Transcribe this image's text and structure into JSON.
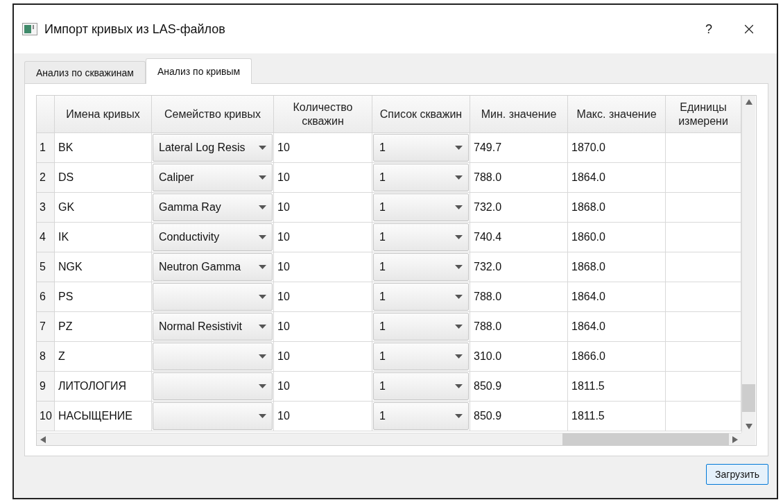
{
  "window": {
    "title": "Импорт кривых из LAS-файлов",
    "help": "?"
  },
  "tabs": [
    {
      "label": "Анализ по скважинам",
      "selected": false
    },
    {
      "label": "Анализ по кривым",
      "selected": true
    }
  ],
  "table": {
    "columns": [
      "Имена кривых",
      "Семейство кривых",
      "Количество скважин",
      "Список скважин",
      "Мин. значение",
      "Макс. значение",
      "Единицы измерени"
    ],
    "rows": [
      {
        "index": "1",
        "name": "BK",
        "family": "Lateral Log Resis",
        "count": "10",
        "wells": "1",
        "min": "749.7",
        "max": "1870.0"
      },
      {
        "index": "2",
        "name": "DS",
        "family": "Caliper",
        "count": "10",
        "wells": "1",
        "min": "788.0",
        "max": "1864.0"
      },
      {
        "index": "3",
        "name": "GK",
        "family": "Gamma Ray",
        "count": "10",
        "wells": "1",
        "min": "732.0",
        "max": "1868.0"
      },
      {
        "index": "4",
        "name": "IK",
        "family": "Conductivity",
        "count": "10",
        "wells": "1",
        "min": "740.4",
        "max": "1860.0"
      },
      {
        "index": "5",
        "name": "NGK",
        "family": "Neutron Gamma",
        "count": "10",
        "wells": "1",
        "min": "732.0",
        "max": "1868.0"
      },
      {
        "index": "6",
        "name": "PS",
        "count": "10",
        "wells": "1",
        "min": "788.0",
        "max": "1864.0"
      },
      {
        "index": "7",
        "name": "PZ",
        "family": "Normal Resistivit",
        "count": "10",
        "wells": "1",
        "min": "788.0",
        "max": "1864.0"
      },
      {
        "index": "8",
        "name": "Z",
        "count": "10",
        "wells": "1",
        "min": "310.0",
        "max": "1866.0"
      },
      {
        "index": "9",
        "name": "ЛИТОЛОГИЯ",
        "count": "10",
        "wells": "1",
        "min": "850.9",
        "max": "1811.5"
      },
      {
        "index": "10",
        "name": "НАСЫЩЕНИЕ",
        "count": "10",
        "wells": "1",
        "min": "850.9",
        "max": "1811.5"
      }
    ]
  },
  "buttons": [
    "Загрузить"
  ]
}
